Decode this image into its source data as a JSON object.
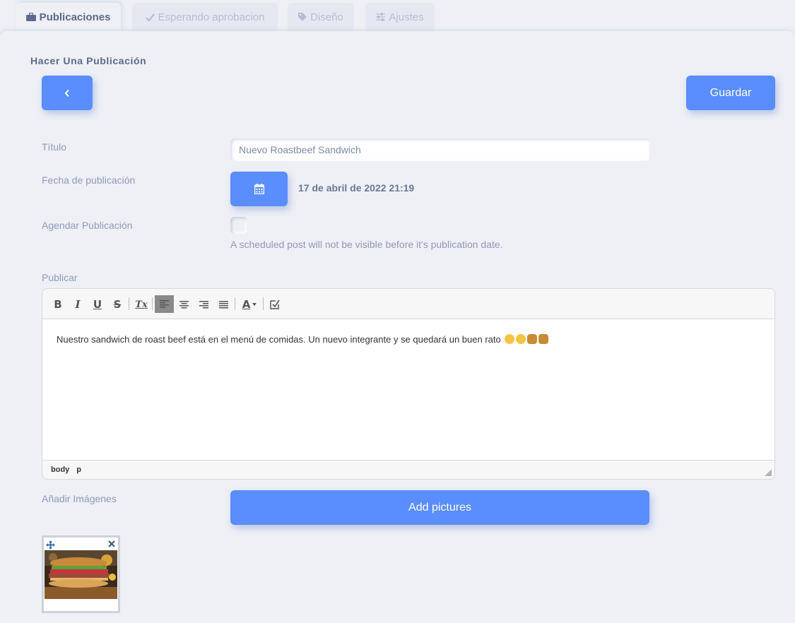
{
  "tabs": [
    {
      "label": "Publicaciones",
      "icon": "briefcase-icon",
      "active": true
    },
    {
      "label": "Esperando aprobacion",
      "icon": "check-icon",
      "active": false
    },
    {
      "label": "Diseño",
      "icon": "tag-icon",
      "active": false
    },
    {
      "label": "Ajustes",
      "icon": "sliders-icon",
      "active": false
    }
  ],
  "form": {
    "section_title": "Hacer Una Publicación",
    "back_label": "‹",
    "save_label": "Guardar",
    "title_label": "Título",
    "title_value": "Nuevo Roastbeef Sandwich",
    "date_label": "Fecha de publicación",
    "date_value": "17 de abril de 2022 21:19",
    "schedule_label": "Agendar Publicación",
    "schedule_hint": "A scheduled post will not be visible before it's publication date.",
    "publish_label": "Publicar",
    "images_label": "Añadir Imágenes",
    "add_pictures_label": "Add pictures"
  },
  "editor": {
    "content": "Nuestro sandwich de roast beef está en el menú de comidas. Un nuevo integrante y se quedará un buen rato",
    "status_path": [
      "body",
      "p"
    ],
    "toolbar": {
      "bold": "B",
      "italic": "I",
      "underline": "U",
      "strike": "S",
      "clear_format": "Tx",
      "text_color": "A"
    }
  },
  "colors": {
    "accent": "#5a8dfd",
    "background": "#eef0f6"
  }
}
